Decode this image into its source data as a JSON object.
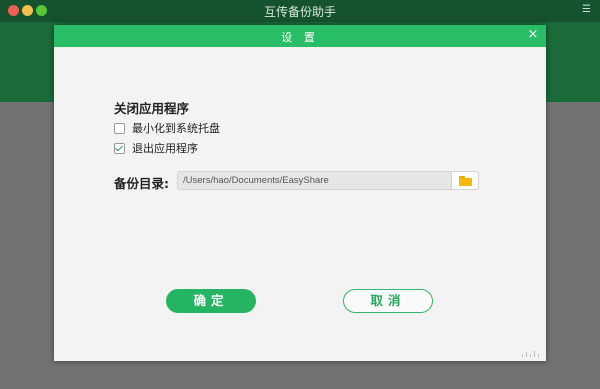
{
  "app": {
    "title": "互传备份助手"
  },
  "dialog": {
    "title": "设 置",
    "close_icon": "×",
    "close_section": {
      "title": "关闭应用程序",
      "options": [
        {
          "label": "最小化到系统托盘",
          "checked": false
        },
        {
          "label": "退出应用程序",
          "checked": true
        }
      ]
    },
    "backup": {
      "label": "备份目录:",
      "path": "/Users/hao/Documents/EasyShare"
    },
    "buttons": {
      "ok": "确定",
      "cancel": "取消"
    }
  },
  "colors": {
    "accent": "#29be66",
    "header_dark": "#1b6b3b",
    "folder": "#f5b80a"
  }
}
